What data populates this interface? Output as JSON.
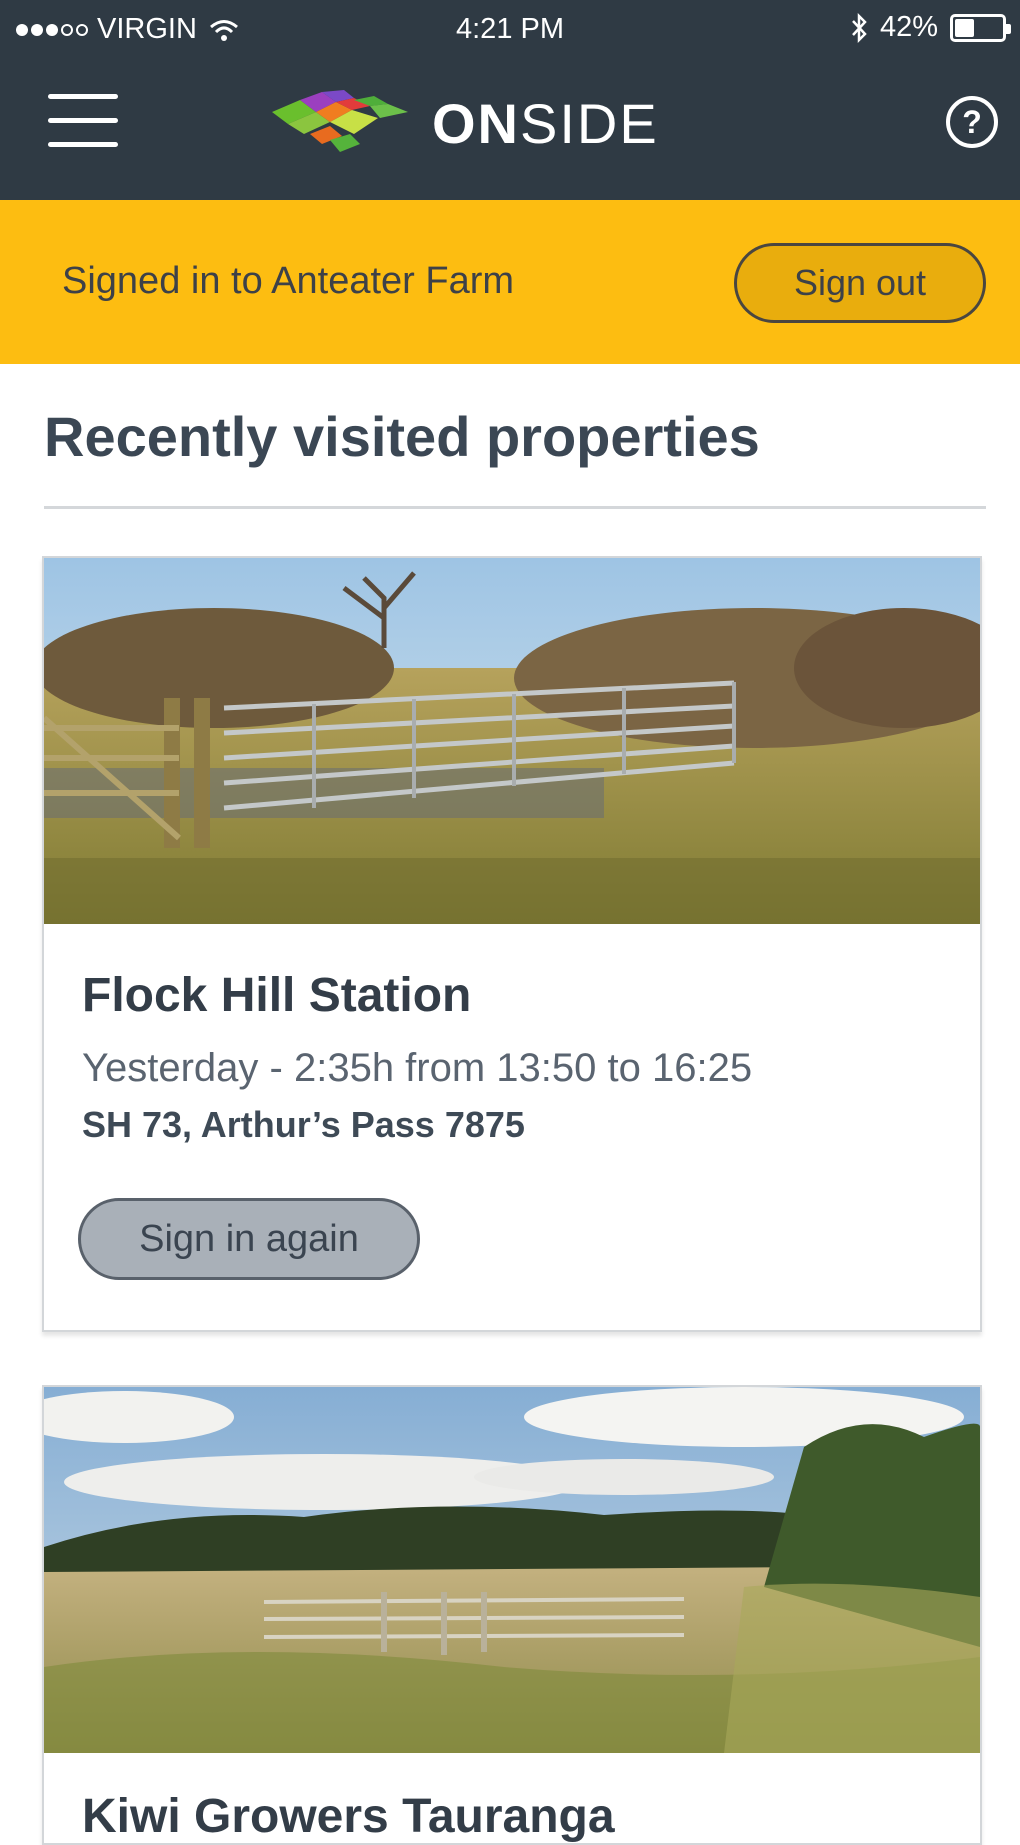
{
  "status_bar": {
    "carrier": "VIRGIN",
    "time": "4:21 PM",
    "battery_percent": "42%",
    "battery_level": 0.42,
    "icons": [
      "signal-dots-icon",
      "wifi-icon",
      "bluetooth-icon",
      "battery-icon"
    ]
  },
  "header": {
    "menu_icon": "hamburger-menu-icon",
    "logo_text_bold": "ON",
    "logo_text_light": "SIDE",
    "help_label": "?",
    "colors": {
      "background": "#2f3a44"
    }
  },
  "banner": {
    "text": "Signed in to Anteater Farm",
    "sign_out_label": "Sign out",
    "colors": {
      "background": "#fdbd11"
    }
  },
  "section": {
    "title": "Recently visited properties"
  },
  "properties": [
    {
      "name": "Flock Hill Station",
      "visit": "Yesterday - 2:35h from 13:50 to 16:25",
      "address": "SH 73, Arthur’s Pass 7875",
      "action_label": "Sign in again"
    },
    {
      "name": "Kiwi Growers Tauranga"
    }
  ]
}
